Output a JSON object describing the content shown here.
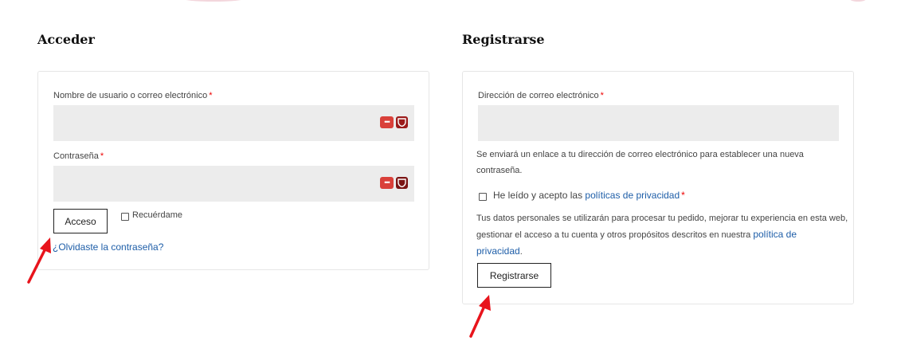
{
  "login": {
    "title": "Acceder",
    "username_label": "Nombre de usuario o correo electrónico",
    "password_label": "Contraseña",
    "required_mark": "*",
    "username_value": "",
    "password_value": "",
    "submit_label": "Acceso",
    "remember_label": "Recuérdame",
    "forgot_link": "¿Olvidaste la contraseña?",
    "pm_dots": "•••"
  },
  "register": {
    "title": "Registrarse",
    "email_label": "Dirección de correo electrónico",
    "required_mark": "*",
    "email_value": "",
    "info_line1": "Se enviará un enlace a tu dirección de correo electrónico para establecer una nueva",
    "info_line2": "contraseña.",
    "privacy_check_prefix": "He leído y acepto las",
    "privacy_check_link": "políticas de privacidad",
    "privacy_text_line1": "Tus datos personales se utilizarán para procesar tu pedido, mejorar tu experiencia en esta web,",
    "privacy_text_line2": "gestionar el acceso a tu cuenta y otros propósitos descritos en nuestra",
    "privacy_link_part1": "política de",
    "privacy_link_part2": "privacidad",
    "privacy_period": ".",
    "submit_label": "Registrarse"
  },
  "colors": {
    "accent_link": "#1e5ea8",
    "required": "#ee0000",
    "annotation_arrow": "#e8141c",
    "input_bg": "#ececec"
  },
  "icons": [
    "password-manager-dots-icon",
    "password-manager-shield-icon",
    "annotation-arrow-icon"
  ]
}
